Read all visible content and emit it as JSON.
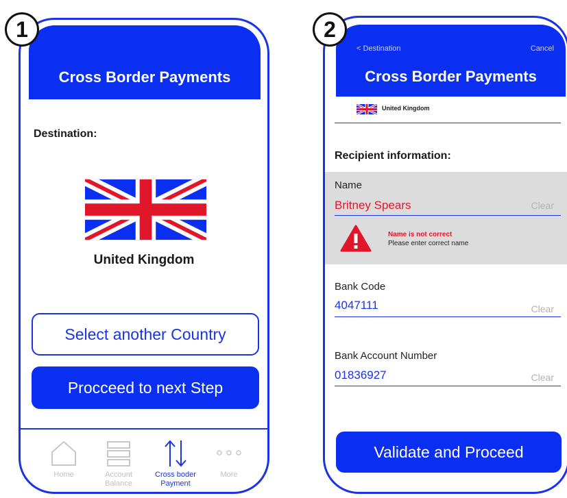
{
  "screen1": {
    "step": "1",
    "header_title": "Cross Border Payments",
    "destination_label": "Destination:",
    "country_name": "United Kingdom",
    "select_button": "Select another Country",
    "proceed_button": "Procceed to next Step",
    "nav": [
      {
        "label": "Home",
        "icon": "home-icon",
        "active": false
      },
      {
        "label": "Account\nBalance",
        "icon": "account-balance-icon",
        "active": false
      },
      {
        "label": "Cross boder\nPayment",
        "icon": "transfer-arrows-icon",
        "active": true
      },
      {
        "label": "More",
        "icon": "more-dots-icon",
        "active": false
      }
    ]
  },
  "screen2": {
    "step": "2",
    "back_link": "< Destination",
    "cancel_link": "Cancel",
    "header_title": "Cross Border Payments",
    "selected_country": "United Kingdom",
    "recipient_heading": "Recipient information:",
    "name_label": "Name",
    "name_value": "Britney Spears",
    "clear_label": "Clear",
    "error_title": "Name is not correct",
    "error_message": "Please enter correct name",
    "bank_code_label": "Bank Code",
    "bank_code_value": "4047111",
    "account_label": "Bank Account Number",
    "account_value": "01836927",
    "validate_button": "Validate and Proceed"
  },
  "colors": {
    "accent": "#0a2ff0",
    "error": "#e0172b",
    "highlight_bg": "#dcdcdc",
    "muted": "#b3b3b3"
  }
}
